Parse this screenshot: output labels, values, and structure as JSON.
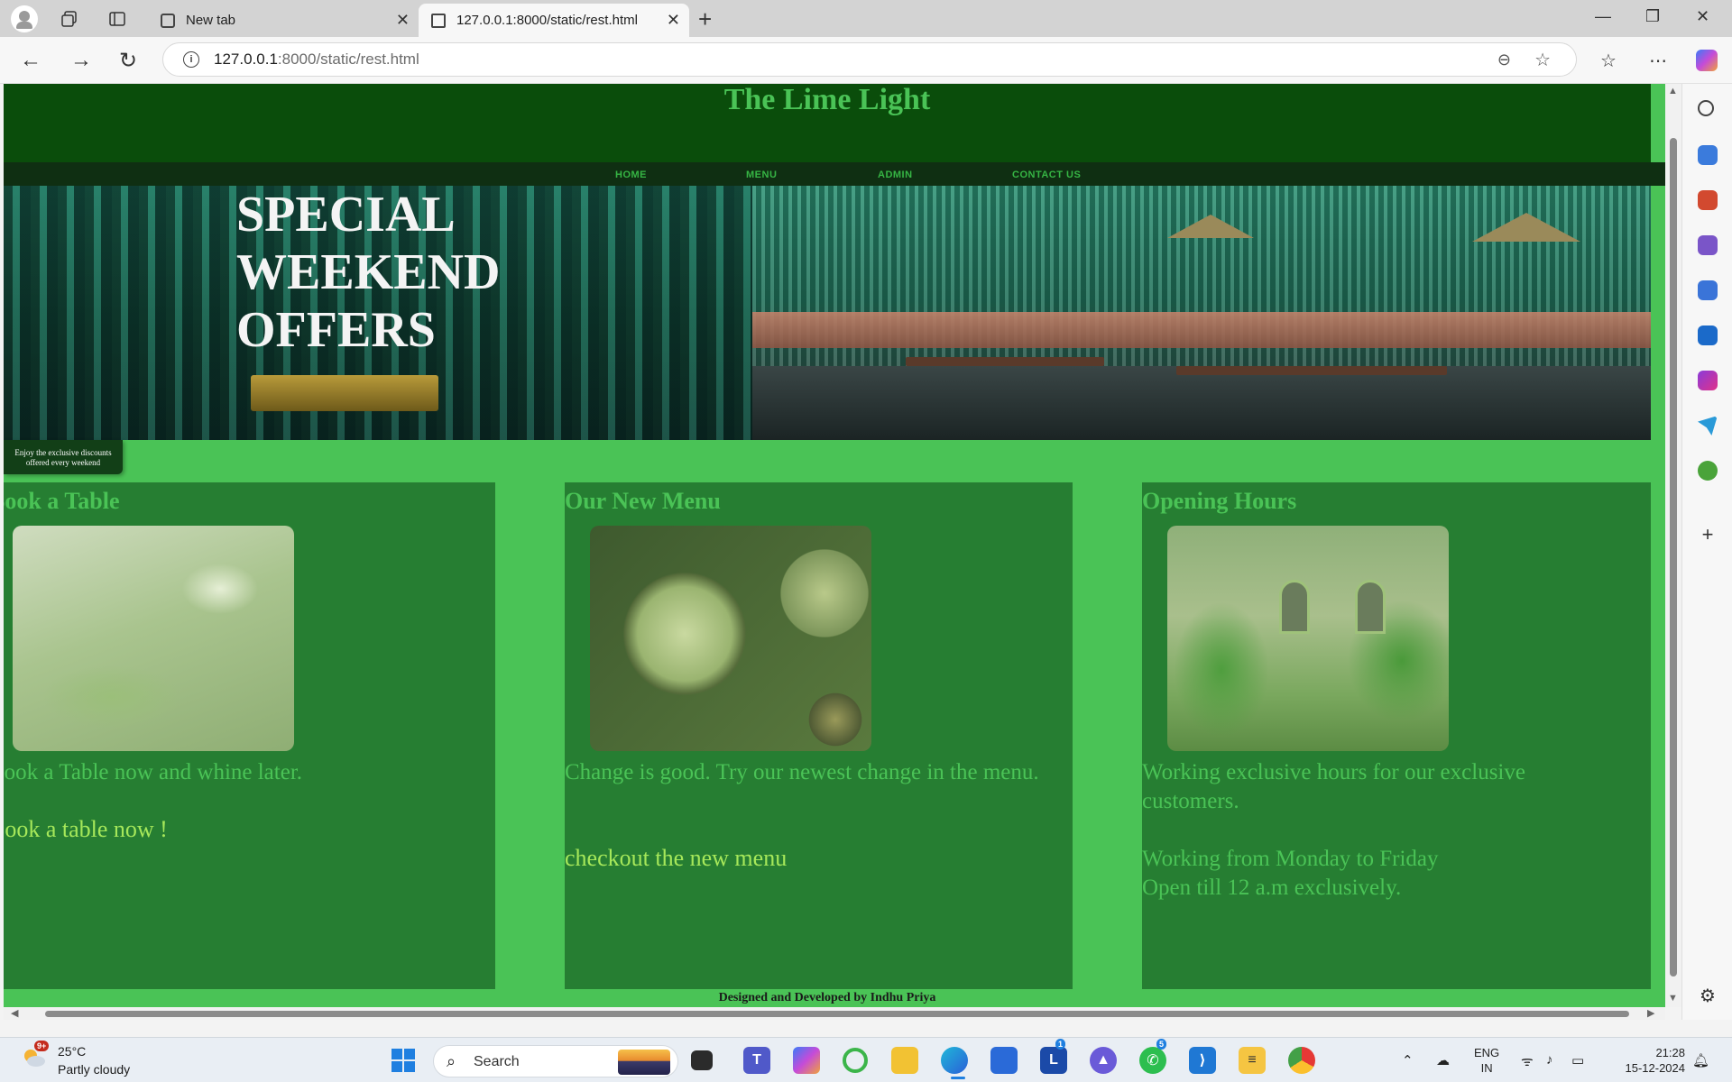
{
  "browser": {
    "tabs": [
      {
        "label": "New tab"
      },
      {
        "label": "127.0.0.1:8000/static/rest.html"
      }
    ],
    "url_host": "127.0.0.1",
    "url_path": ":8000/static/rest.html"
  },
  "site": {
    "title": "The Lime Light",
    "nav": [
      "HOME",
      "MENU",
      "ADMIN",
      "CONTACT US"
    ],
    "hero_title": "SPECIAL WEEKEND OFFERS",
    "offer_badge": "Enjoy the exclusive discounts offered every weekend",
    "cards": [
      {
        "title": "Book a Table",
        "text": "Book a Table now and whine later.",
        "link": "Book a table now !"
      },
      {
        "title": "Our New Menu",
        "text": "Change is good. Try our newest change in the menu.",
        "link": "checkout the new menu"
      },
      {
        "title": "Opening Hours",
        "text": "Working exclusive hours for our exclusive customers.",
        "extra1": "Working from Monday to Friday",
        "extra2": "Open till 12 a.m exclusively."
      }
    ],
    "footer": "Designed and Developed by Indhu Priya",
    "colors": {
      "header": "#0a4d0b",
      "accent": "#4ac356",
      "card": "#267e32",
      "link": "#a6e85a"
    }
  },
  "taskbar": {
    "weather_temp": "25°C",
    "weather_desc": "Partly cloudy",
    "weather_badge": "9+",
    "search_label": "Search",
    "lang_line1": "ENG",
    "lang_line2": "IN",
    "time": "21:28",
    "date": "15-12-2024",
    "outlook_badge": "1",
    "whatsapp_badge": "5"
  }
}
